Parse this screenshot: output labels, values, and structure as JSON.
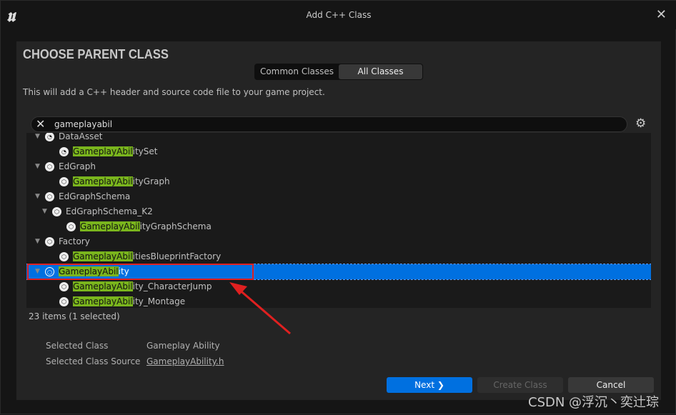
{
  "window": {
    "title": "Add C++ Class",
    "logo": "U"
  },
  "heading": "CHOOSE PARENT CLASS",
  "tabs": [
    {
      "label": "Common Classes",
      "active": false
    },
    {
      "label": "All Classes",
      "active": true
    }
  ],
  "description": "This will add a C++ header and source code file to your game project.",
  "search": {
    "value": "gameplayabil",
    "icon": "gear-icon"
  },
  "highlight_color": "#7ab51d",
  "tree": [
    {
      "label": "DataAsset",
      "match": "",
      "rest": "DataAsset",
      "level": 0,
      "expand": true,
      "icon": "data-asset-icon"
    },
    {
      "label": "GameplayAbilitySet",
      "match": "GameplayAbil",
      "rest": "itySet",
      "level": 1,
      "expand": false,
      "icon": "data-asset-icon"
    },
    {
      "label": "EdGraph",
      "match": "",
      "rest": "EdGraph",
      "level": 0,
      "expand": true,
      "icon": "class-icon"
    },
    {
      "label": "GameplayAbilityGraph",
      "match": "GameplayAbil",
      "rest": "ityGraph",
      "level": 1,
      "expand": false,
      "icon": "class-icon"
    },
    {
      "label": "EdGraphSchema",
      "match": "",
      "rest": "EdGraphSchema",
      "level": 0,
      "expand": true,
      "icon": "class-icon"
    },
    {
      "label": "EdGraphSchema_K2",
      "match": "",
      "rest": "EdGraphSchema_K2",
      "level": 1,
      "expand": true,
      "icon": "class-icon"
    },
    {
      "label": "GameplayAbilityGraphSchema",
      "match": "GameplayAbil",
      "rest": "ityGraphSchema",
      "level": 2,
      "expand": false,
      "icon": "class-icon"
    },
    {
      "label": "Factory",
      "match": "",
      "rest": "Factory",
      "level": 0,
      "expand": true,
      "icon": "class-icon"
    },
    {
      "label": "GameplayAbilitiesBlueprintFactory",
      "match": "GameplayAbil",
      "rest": "itiesBlueprintFactory",
      "level": 1,
      "expand": false,
      "icon": "class-icon"
    },
    {
      "label": "GameplayAbility",
      "match": "GameplayAbil",
      "rest": "ity",
      "level": 0,
      "expand": true,
      "icon": "class-icon",
      "selected": true
    },
    {
      "label": "GameplayAbility_CharacterJump",
      "match": "GameplayAbil",
      "rest": "ity_CharacterJump",
      "level": 1,
      "expand": false,
      "icon": "class-icon"
    },
    {
      "label": "GameplayAbility_Montage",
      "match": "GameplayAbil",
      "rest": "ity_Montage",
      "level": 1,
      "expand": false,
      "icon": "class-icon"
    }
  ],
  "item_count": "23 items (1 selected)",
  "details": {
    "selected_class_label": "Selected Class",
    "selected_class": "Gameplay Ability",
    "source_label": "Selected Class Source",
    "source": "GameplayAbility.h"
  },
  "buttons": {
    "next": "Next ❯",
    "create": "Create Class",
    "cancel": "Cancel"
  },
  "watermark": "CSDN @浮沉丶奕辻琮"
}
